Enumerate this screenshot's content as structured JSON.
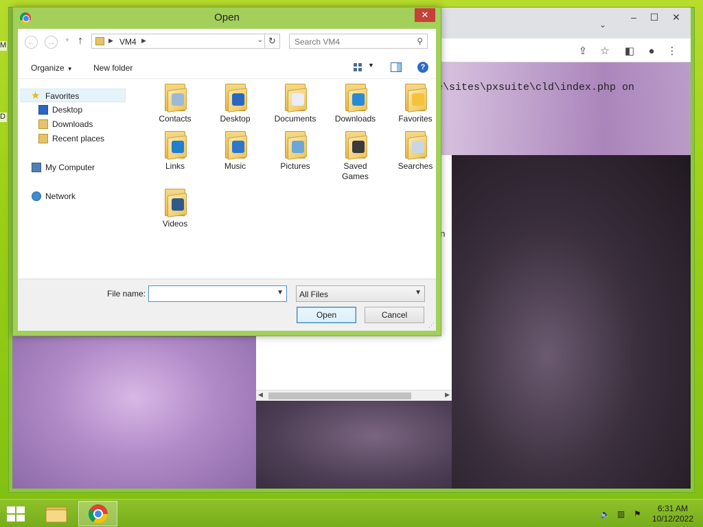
{
  "desktop": {
    "edge_glyphs": [
      "M",
      "D"
    ]
  },
  "browser": {
    "path_text": "e\\sites\\pxsuite\\cld\\index.php on",
    "fragment_text": "n"
  },
  "dialog": {
    "title": "Open",
    "close_label": "✕",
    "address": {
      "location": "VM4"
    },
    "search": {
      "placeholder": "Search VM4"
    },
    "commands": {
      "organize": "Organize",
      "new_folder": "New folder",
      "help": "?"
    },
    "nav": {
      "favorites": "Favorites",
      "desktop": "Desktop",
      "downloads": "Downloads",
      "recent_places": "Recent places",
      "my_computer": "My Computer",
      "network": "Network"
    },
    "files": [
      {
        "label": "Contacts",
        "icon": "contacts-folder-icon",
        "overlay": "#9cb9d6"
      },
      {
        "label": "Desktop",
        "icon": "desktop-folder-icon",
        "overlay": "#2b66c4"
      },
      {
        "label": "Documents",
        "icon": "documents-folder-icon",
        "overlay": "#e9eef5"
      },
      {
        "label": "Downloads",
        "icon": "downloads-folder-icon",
        "overlay": "#2a8ad6"
      },
      {
        "label": "Favorites",
        "icon": "favorites-folder-icon",
        "overlay": "#f5c23a"
      },
      {
        "label": "Links",
        "icon": "links-folder-icon",
        "overlay": "#1f7fd0"
      },
      {
        "label": "Music",
        "icon": "music-folder-icon",
        "overlay": "#2f78c9"
      },
      {
        "label": "Pictures",
        "icon": "pictures-folder-icon",
        "overlay": "#6fa6d8"
      },
      {
        "label": "Saved\nGames",
        "icon": "saved-games-folder-icon",
        "overlay": "#3b3b3b"
      },
      {
        "label": "Searches",
        "icon": "searches-folder-icon",
        "overlay": "#c9d6e3"
      },
      {
        "label": "Videos",
        "icon": "videos-folder-icon",
        "overlay": "#2d5a8a"
      }
    ],
    "file_name": {
      "label": "File name:",
      "value": ""
    },
    "file_type": "All Files",
    "buttons": {
      "open": "Open",
      "cancel": "Cancel"
    }
  },
  "taskbar": {
    "time": "6:31 AM",
    "date": "10/12/2022"
  }
}
